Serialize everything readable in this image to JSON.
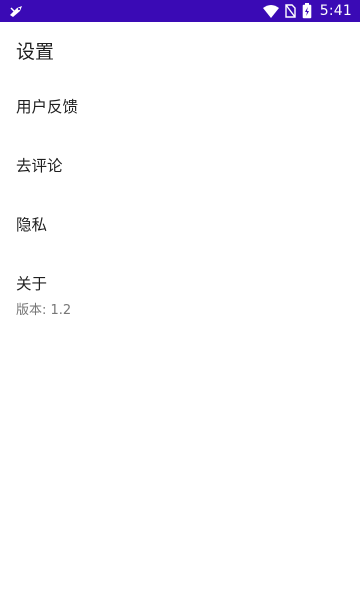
{
  "status_bar": {
    "time": "5:41",
    "background": "#3a0ab5",
    "icons": [
      "app-notification-icon",
      "wifi-icon",
      "no-sim-icon",
      "battery-charging-icon"
    ]
  },
  "page": {
    "title": "设置"
  },
  "settings": {
    "items": [
      {
        "label": "用户反馈"
      },
      {
        "label": "去评论"
      },
      {
        "label": "隐私"
      },
      {
        "label": "关于",
        "subtext": "版本: 1.2"
      }
    ]
  }
}
